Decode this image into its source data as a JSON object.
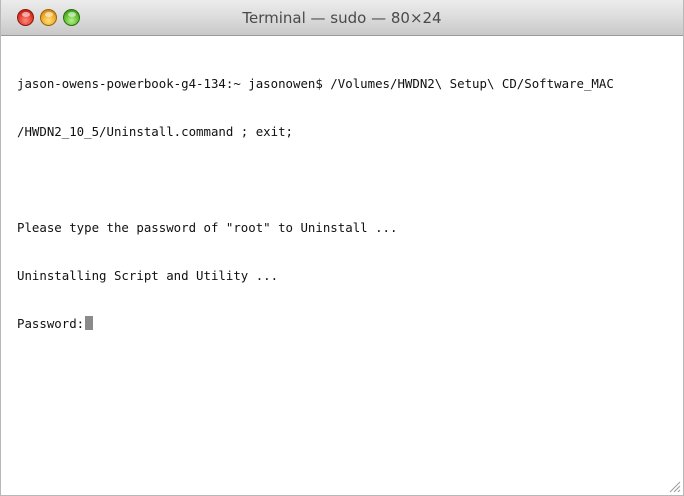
{
  "window": {
    "title": "Terminal — sudo — 80×24"
  },
  "terminal": {
    "lines": [
      "jason-owens-powerbook-g4-134:~ jasonowen$ /Volumes/HWDN2\\ Setup\\ CD/Software_MAC",
      "/HWDN2_10_5/Uninstall.command ; exit;",
      "",
      "Please type the password of \"root\" to Uninstall ...",
      "Uninstalling Script and Utility ...",
      "Password:"
    ]
  },
  "icons": {
    "close": "close-button-icon",
    "minimize": "minimize-button-icon",
    "zoom": "zoom-button-icon",
    "resize": "resize-grip-icon"
  },
  "colors": {
    "close": "#e0392c",
    "minimize": "#f0a82a",
    "zoom": "#5cbf2e",
    "cursor": "#8a8a8a"
  }
}
